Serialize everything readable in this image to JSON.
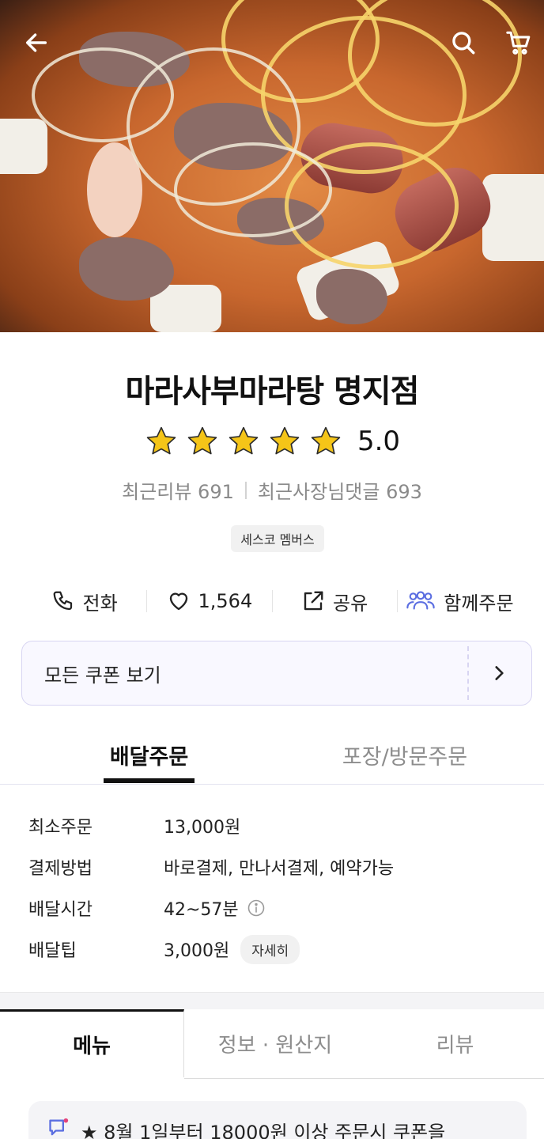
{
  "header": {
    "back_icon": "arrow-left-icon",
    "search_icon": "search-icon",
    "cart_icon": "cart-icon",
    "photo_label": "마라탕 food photo"
  },
  "store": {
    "name": "마라사부마라탕 명지점",
    "rating_stars": 5,
    "rating_value": "5.0",
    "recent_reviews": "최근리뷰 691",
    "owner_replies": "최근사장님댓글 693",
    "member_badge": "세스코 멤버스"
  },
  "actions": {
    "call": "전화",
    "likes": "1,564",
    "share": "공유",
    "group_order": "함께주문"
  },
  "coupon": {
    "label": "모든 쿠폰 보기"
  },
  "order_tabs": {
    "delivery": "배달주문",
    "pickup": "포장/방문주문"
  },
  "info": {
    "min_order_label": "최소주문",
    "min_order_value": "13,000원",
    "payment_label": "결제방법",
    "payment_value": "바로결제, 만나서결제, 예약가능",
    "delivery_time_label": "배달시간",
    "delivery_time_value": "42~57분",
    "delivery_tip_label": "배달팁",
    "delivery_tip_value": "3,000원",
    "detail_button": "자세히"
  },
  "bottom_tabs": {
    "menu": "메뉴",
    "info_origin": "정보 · 원산지",
    "review": "리뷰"
  },
  "notice": {
    "text": "★ 8월 1일부터 18000원 이상 주문시 쿠폰을"
  },
  "colors": {
    "accent_purple": "#5b6ee1",
    "notice_pink": "#e4437a",
    "star_gold": "#f5c518"
  }
}
